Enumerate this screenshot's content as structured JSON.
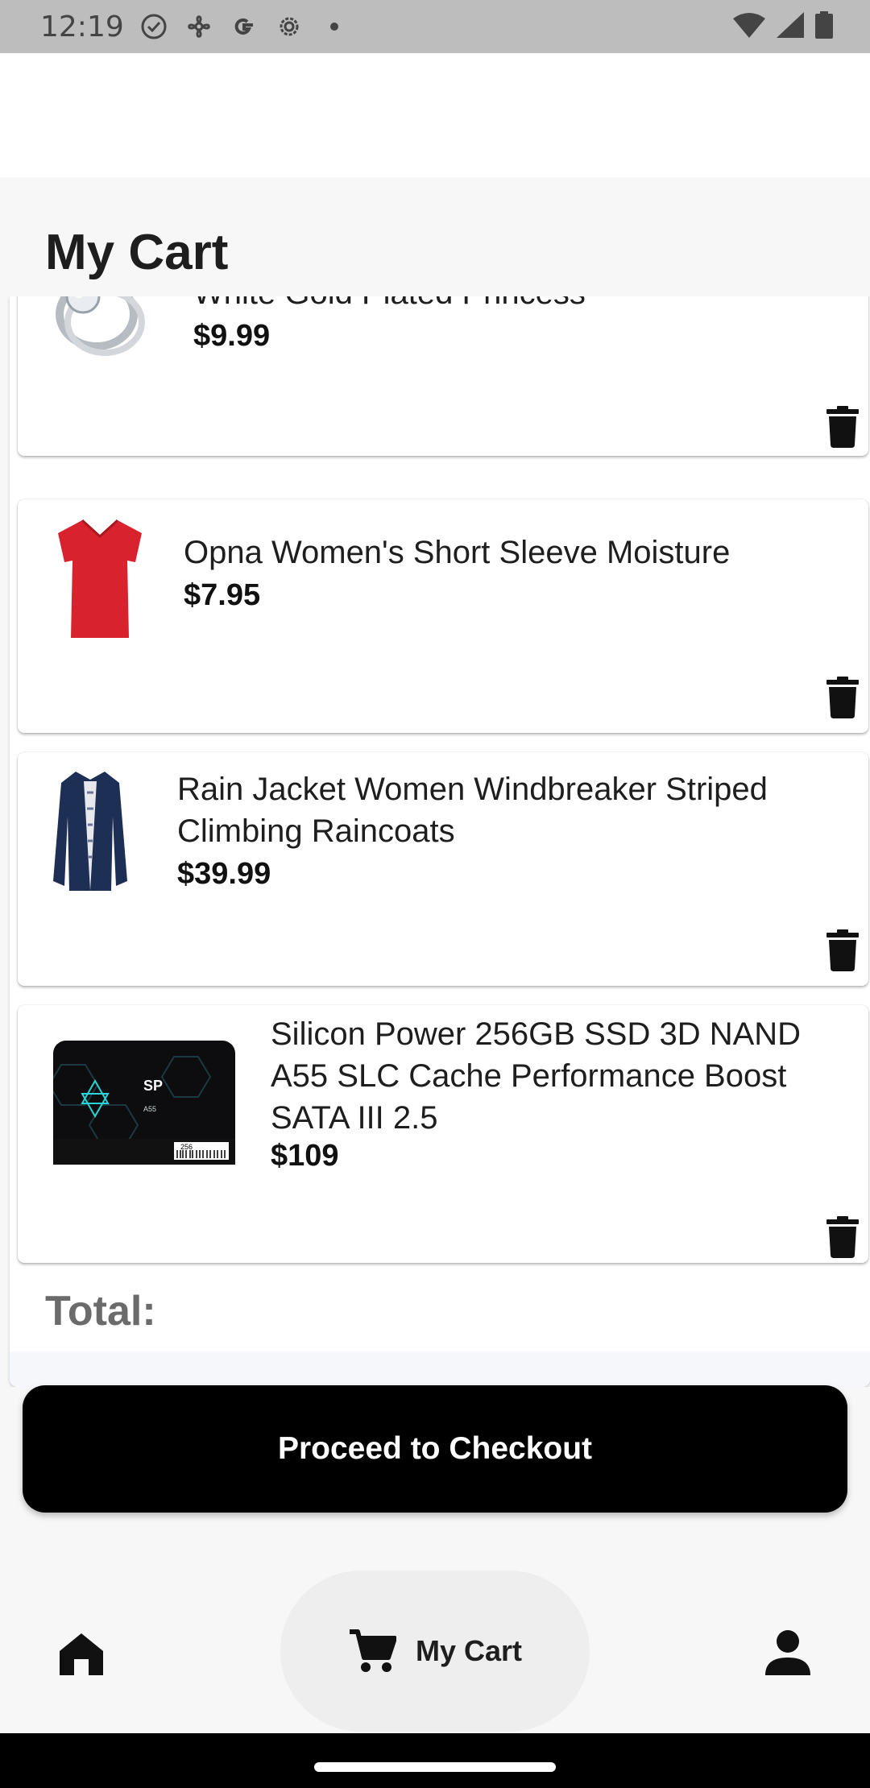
{
  "status_bar": {
    "time": "12:19",
    "icons": [
      "check-circle-icon",
      "fan-icon",
      "google-icon",
      "settings-icon",
      "dot-icon",
      "wifi-icon",
      "signal-icon",
      "battery-icon"
    ]
  },
  "page": {
    "title": "My Cart"
  },
  "cart_items": [
    {
      "name": "White Gold Plated Princess",
      "price": "$9.99"
    },
    {
      "name": "Opna Women's Short Sleeve Moisture",
      "price": "$7.95"
    },
    {
      "name": "Rain Jacket Women Windbreaker Striped Climbing Raincoats",
      "price": "$39.99"
    },
    {
      "name": "Silicon Power 256GB SSD 3D NAND A55 SLC Cache Performance Boost SATA III 2.5",
      "price": "$109"
    }
  ],
  "total": {
    "label": "Total:"
  },
  "checkout": {
    "label": "Proceed to Checkout"
  },
  "bottom_nav": {
    "items": [
      {
        "icon": "home-icon"
      },
      {
        "icon": "cart-icon",
        "label": "My Cart",
        "active": true
      },
      {
        "icon": "person-icon"
      }
    ]
  },
  "colors": {
    "accent": "#000000",
    "background": "#f7f7f7",
    "status_bar": "#bdbdbd",
    "shirt": "#d8232e",
    "jacket": "#1d2f55"
  },
  "ssd_label": {
    "brand": "SP",
    "model": "A55",
    "capacity": "256"
  }
}
